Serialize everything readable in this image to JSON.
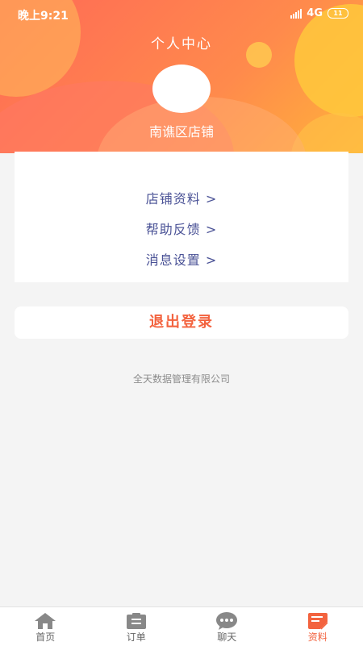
{
  "status": {
    "time": "晚上9:21",
    "network": "4G",
    "battery": "11"
  },
  "header": {
    "title": "个人中心",
    "store_name": "南谯区店铺"
  },
  "menu": {
    "items": [
      {
        "label": "店铺资料 >"
      },
      {
        "label": "帮助反馈 >"
      },
      {
        "label": "消息设置 >"
      }
    ]
  },
  "logout": {
    "label": "退出登录"
  },
  "footer": {
    "company": "全天数据管理有限公司"
  },
  "tabs": [
    {
      "label": "首页",
      "icon": "home-icon"
    },
    {
      "label": "订单",
      "icon": "order-icon"
    },
    {
      "label": "聊天",
      "icon": "chat-icon"
    },
    {
      "label": "资料",
      "icon": "profile-icon",
      "active": true
    }
  ],
  "colors": {
    "accent": "#f3633f",
    "menu_text": "#4a5296",
    "tab_icon": "#888888"
  }
}
